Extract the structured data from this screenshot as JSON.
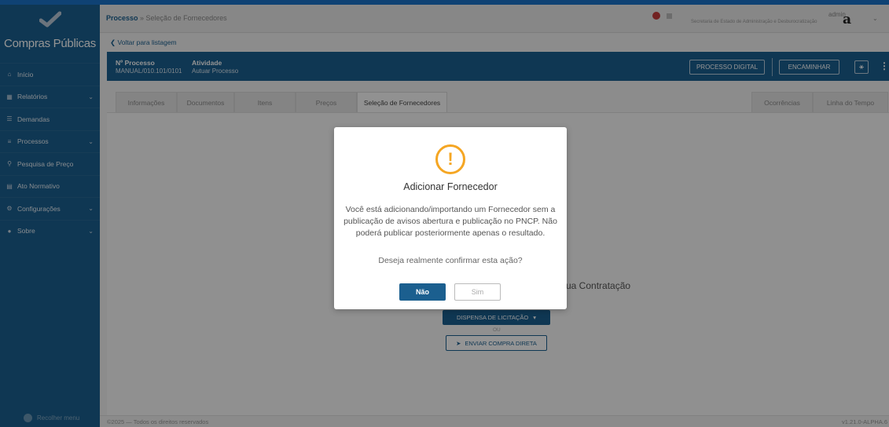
{
  "app": {
    "title": "Compras Públicas",
    "brand_color": "#1b5f8f",
    "accent_color": "#1a73c8",
    "warning_color": "#f5a623"
  },
  "sidebar": {
    "items": [
      {
        "label": "Início",
        "icon": "home-icon",
        "glyph": "⌂",
        "has_chevron": false
      },
      {
        "label": "Relatórios",
        "icon": "reports-icon",
        "glyph": "▦",
        "has_chevron": true
      },
      {
        "label": "Demandas",
        "icon": "demands-icon",
        "glyph": "☰",
        "has_chevron": false
      },
      {
        "label": "Processos",
        "icon": "processes-icon",
        "glyph": "≡",
        "has_chevron": true
      },
      {
        "label": "Pesquisa de Preço",
        "icon": "search-icon",
        "glyph": "⚲",
        "has_chevron": false
      },
      {
        "label": "Ato Normativo",
        "icon": "document-icon",
        "glyph": "▤",
        "has_chevron": false
      },
      {
        "label": "Configurações",
        "icon": "gear-icon",
        "glyph": "⚙",
        "has_chevron": true
      },
      {
        "label": "Sobre",
        "icon": "info-icon",
        "glyph": "●",
        "has_chevron": true
      }
    ],
    "collapse_label": "Recolher menu"
  },
  "header": {
    "breadcrumb_root": "Processo",
    "breadcrumb_sep": " » ",
    "breadcrumb_current": "Seleção de Fornecedores",
    "secretaria": "Secretaria de Estado de Administração e Desburocratização",
    "user": "admin"
  },
  "back_link": "Voltar para listagem",
  "process": {
    "number_label": "Nº Processo",
    "number_value": "MANUAL/010.101/0101",
    "activity_label": "Atividade",
    "activity_value": "Autuar Processo",
    "btn_digital": "PROCESSO DIGITAL",
    "btn_encaminhar": "ENCAMINHAR"
  },
  "tabs": {
    "informacoes": "Informações",
    "documentos": "Documentos",
    "itens": "Itens",
    "precos": "Preços",
    "selecao": "Seleção de Fornecedores",
    "ocorrencias": "Ocorrências",
    "linha": "Linha do Tempo"
  },
  "main": {
    "contratacao_text": "ua Contratação",
    "dispensa_btn": "DISPENSA DE LICITAÇÃO",
    "ou": "OU",
    "enviar_btn": "ENVIAR COMPRA DIRETA"
  },
  "modal": {
    "icon": "warning-icon",
    "title": "Adicionar Fornecedor",
    "message": "Você está adicionando/importando um Fornecedor sem a publicação de avisos abertura e publicação no PNCP. Não poderá publicar posteriormente apenas o resultado.",
    "question": "Deseja realmente confirmar esta ação?",
    "btn_no": "Não",
    "btn_yes": "Sim"
  },
  "footer": {
    "copyright": "©2025 — Todos os direitos reservados",
    "version": "v1.21.0-ALPHA.6"
  }
}
